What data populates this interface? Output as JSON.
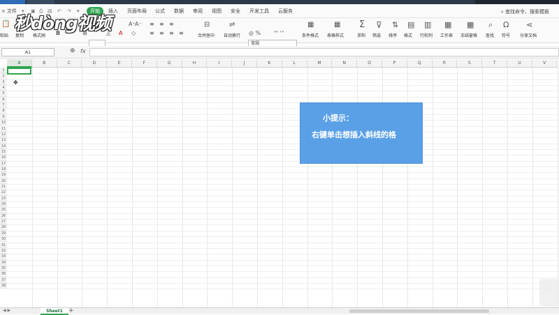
{
  "menu": {
    "file": "文件",
    "tabs": [
      "开始",
      "插入",
      "页面布局",
      "公式",
      "数据",
      "审阅",
      "视图",
      "安全",
      "开发工具",
      "云服务"
    ],
    "active_tab": "开始",
    "search_cmd": "查找命令、搜索模板"
  },
  "watermark": "秒dòng视频",
  "ribbon": {
    "paste": "粘贴",
    "copy": "复制",
    "format_painter": "格式刷",
    "merge_center": "合并居中",
    "wrap_text": "自动换行",
    "number_format": "常规",
    "cond_format": "条件格式",
    "table_style": "表格样式",
    "sum": "求和",
    "filter": "筛选",
    "sort": "排序",
    "format": "格式",
    "row_col": "行和列",
    "worksheet": "工作表",
    "freeze": "冻结窗格",
    "find": "查找",
    "symbol": "符号",
    "share": "分享文档"
  },
  "formula_bar": {
    "name_box": "A1",
    "fx": "fx",
    "formula": ""
  },
  "columns": [
    "A",
    "B",
    "C",
    "D",
    "E",
    "F",
    "G",
    "H",
    "I",
    "J",
    "K",
    "L",
    "M",
    "N",
    "O",
    "P",
    "Q",
    "R",
    "S",
    "T",
    "U",
    "V"
  ],
  "rows": [
    "1",
    "2",
    "3",
    "4",
    "5",
    "6",
    "7",
    "8",
    "9",
    "10",
    "11",
    "12",
    "13",
    "14",
    "15",
    "16",
    "17",
    "18",
    "19",
    "20",
    "21",
    "22",
    "23",
    "24",
    "25",
    "26",
    "27",
    "28",
    "29",
    "30",
    "31",
    "32",
    "33",
    "34",
    "35",
    "36",
    "37",
    "38"
  ],
  "sheet": {
    "tab": "Sheet1",
    "add": "+"
  },
  "tip": {
    "title": "小提示：",
    "body": "右键单击想插入斜线的格"
  },
  "colors": {
    "accent": "#2ea44f",
    "tip_bg": "#5aa0e6"
  }
}
